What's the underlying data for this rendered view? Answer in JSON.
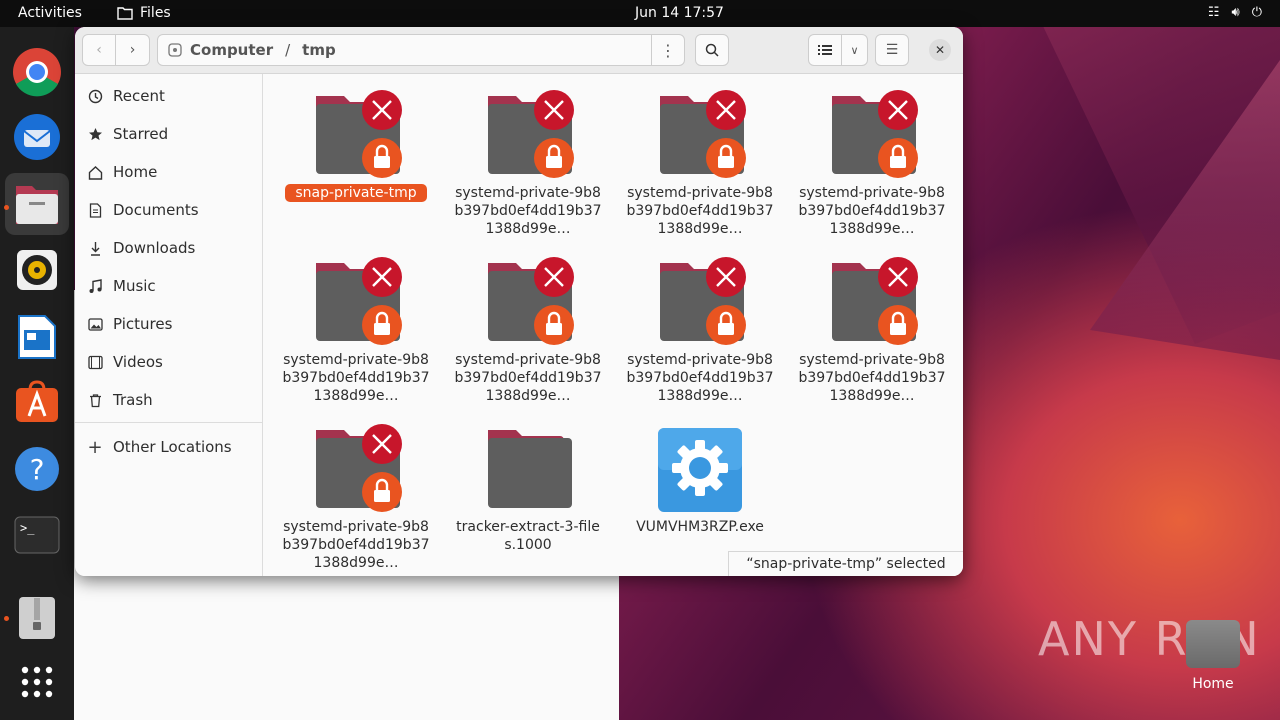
{
  "topbar": {
    "activities": "Activities",
    "app": "Files",
    "clock": "Jun 14  17:57"
  },
  "path": {
    "root": "Computer",
    "sep": "/",
    "current": "tmp"
  },
  "sidebar": {
    "items": [
      {
        "label": "Recent",
        "icon": "clock-icon"
      },
      {
        "label": "Starred",
        "icon": "star-icon"
      },
      {
        "label": "Home",
        "icon": "home-icon"
      },
      {
        "label": "Documents",
        "icon": "document-icon"
      },
      {
        "label": "Downloads",
        "icon": "download-icon"
      },
      {
        "label": "Music",
        "icon": "music-icon"
      },
      {
        "label": "Pictures",
        "icon": "picture-icon"
      },
      {
        "label": "Videos",
        "icon": "video-icon"
      },
      {
        "label": "Trash",
        "icon": "trash-icon"
      }
    ],
    "other": "Other Locations"
  },
  "files": [
    {
      "name": "snap-private-tmp",
      "type": "locked-folder",
      "selected": true
    },
    {
      "name": "systemd-private-9b8b397bd0ef4dd19b371388d99e…",
      "type": "locked-folder"
    },
    {
      "name": "systemd-private-9b8b397bd0ef4dd19b371388d99e…",
      "type": "locked-folder"
    },
    {
      "name": "systemd-private-9b8b397bd0ef4dd19b371388d99e…",
      "type": "locked-folder"
    },
    {
      "name": "systemd-private-9b8b397bd0ef4dd19b371388d99e…",
      "type": "locked-folder"
    },
    {
      "name": "systemd-private-9b8b397bd0ef4dd19b371388d99e…",
      "type": "locked-folder"
    },
    {
      "name": "systemd-private-9b8b397bd0ef4dd19b371388d99e…",
      "type": "locked-folder"
    },
    {
      "name": "systemd-private-9b8b397bd0ef4dd19b371388d99e…",
      "type": "locked-folder"
    },
    {
      "name": "systemd-private-9b8b397bd0ef4dd19b371388d99e…",
      "type": "locked-folder"
    },
    {
      "name": "tracker-extract-3-files.1000",
      "type": "folder"
    },
    {
      "name": "VUMVHM3RZP.exe",
      "type": "executable"
    }
  ],
  "status": "“snap-private-tmp” selected",
  "desktop": {
    "home_label": "Home",
    "watermark": "ANY RUN"
  },
  "colors": {
    "accent": "#e95420",
    "deny": "#c7162b",
    "folder": "#5e5e5e"
  }
}
